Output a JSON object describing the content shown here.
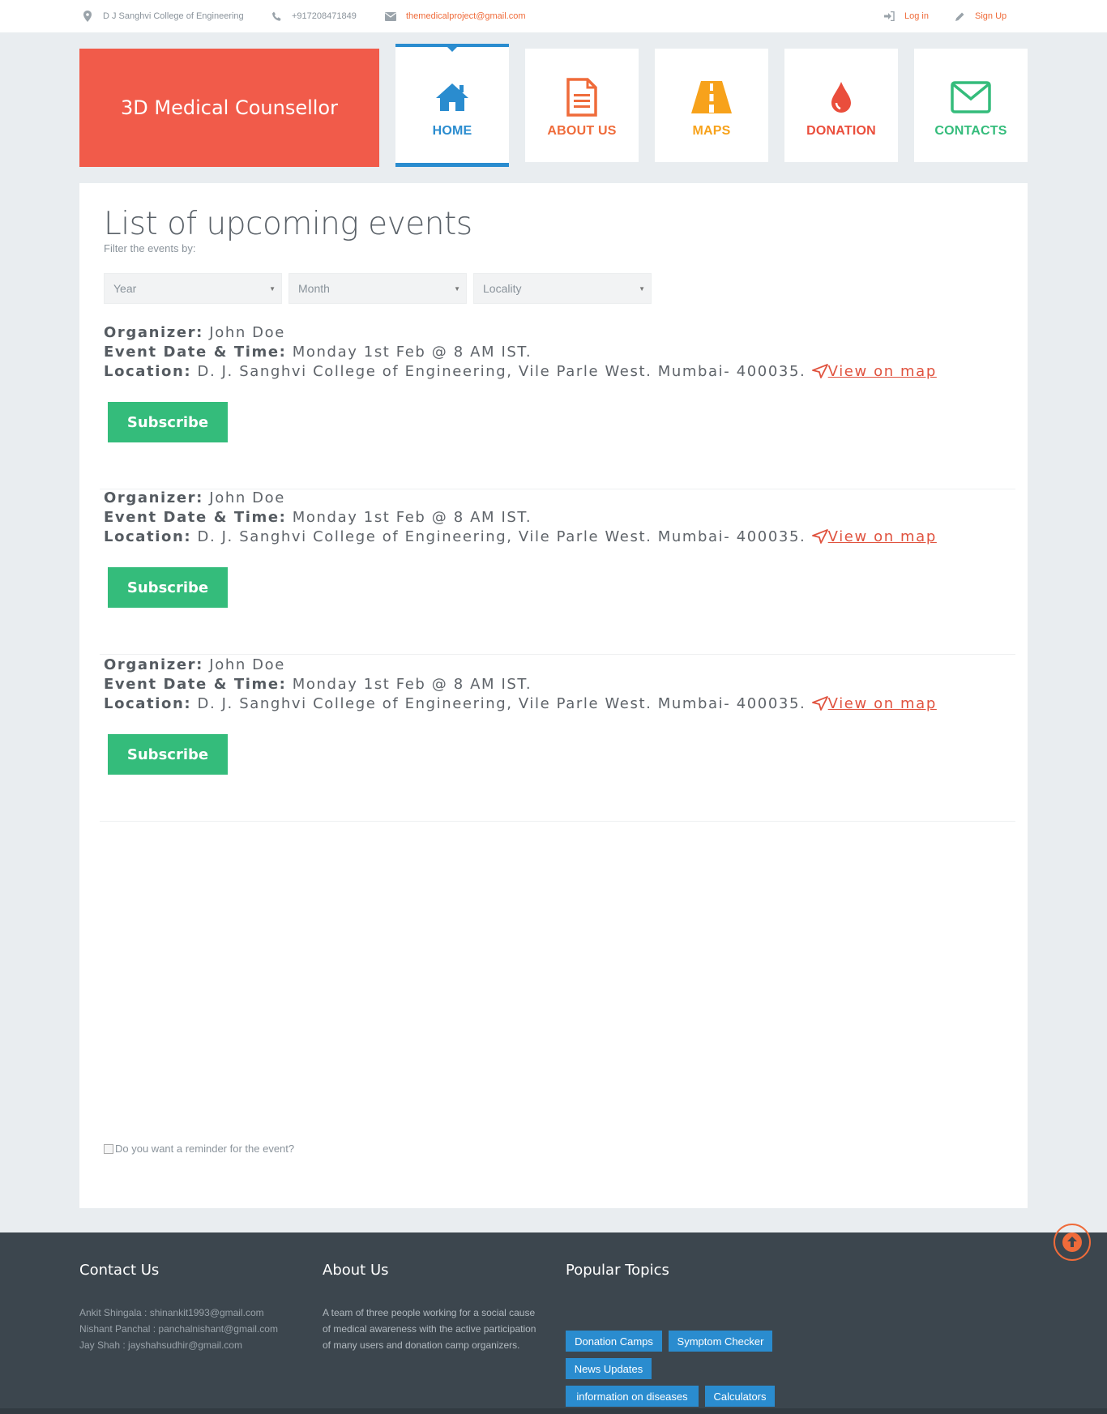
{
  "topbar": {
    "address": "D J Sanghvi College of Engineering",
    "phone": "+917208471849",
    "email": "themedicalproject@gmail.com",
    "login": "Log in",
    "signup": "Sign Up"
  },
  "brand": {
    "name": "3D Medical Counsellor"
  },
  "nav": [
    {
      "label": "HOME",
      "icon": "home-icon",
      "color": "#2a8ccf",
      "active": true
    },
    {
      "label": "ABOUT US",
      "icon": "document-icon",
      "color": "#ef6b3a"
    },
    {
      "label": "MAPS",
      "icon": "road-icon",
      "color": "#f7a21b"
    },
    {
      "label": "DONATION",
      "icon": "blood-drop-icon",
      "color": "#ea4e3c"
    },
    {
      "label": "CONTACTS",
      "icon": "envelope-icon",
      "color": "#34bc7b"
    }
  ],
  "main": {
    "title": "List of upcoming events",
    "subtitle": "Filter the events by:",
    "filters": [
      "Year",
      "Month",
      "Locality"
    ],
    "labels": {
      "organizer": "Organizer:",
      "datetime": "Event Date & Time:",
      "location": "Location:",
      "map": "View on map",
      "subscribe": "Subscribe"
    },
    "events": [
      {
        "organizer": "John Doe",
        "datetime": "Monday 1st Feb @ 8 AM IST.",
        "location": "D. J. Sanghvi College of Engineering, Vile Parle West. Mumbai- 400035."
      },
      {
        "organizer": "John Doe",
        "datetime": "Monday 1st Feb @ 8 AM IST.",
        "location": "D. J. Sanghvi College of Engineering, Vile Parle West. Mumbai- 400035."
      },
      {
        "organizer": "John Doe",
        "datetime": "Monday 1st Feb @ 8 AM IST.",
        "location": "D. J. Sanghvi College of Engineering, Vile Parle West. Mumbai- 400035."
      }
    ],
    "reminder": "Do you want a reminder for the event?"
  },
  "footer": {
    "contact": {
      "title": "Contact Us",
      "lines": [
        "Ankit Shingala : shinankit1993@gmail.com",
        "Nishant Panchal : panchalnishant@gmail.com",
        "Jay Shah : jayshahsudhir@gmail.com"
      ]
    },
    "about": {
      "title": "About Us",
      "text": "A team of three people working for a social cause of medical awareness with the active participation of many users and donation camp organizers."
    },
    "topics": {
      "title": "Popular Topics",
      "tags": [
        "Donation Camps",
        "Symptom Checker",
        "News Updates",
        "information on diseases",
        "Calculators"
      ]
    }
  },
  "colors": {
    "accent": "#f15b4a",
    "primary": "#2a8ccf",
    "success": "#34bc7b",
    "link": "#ef6b3a"
  }
}
